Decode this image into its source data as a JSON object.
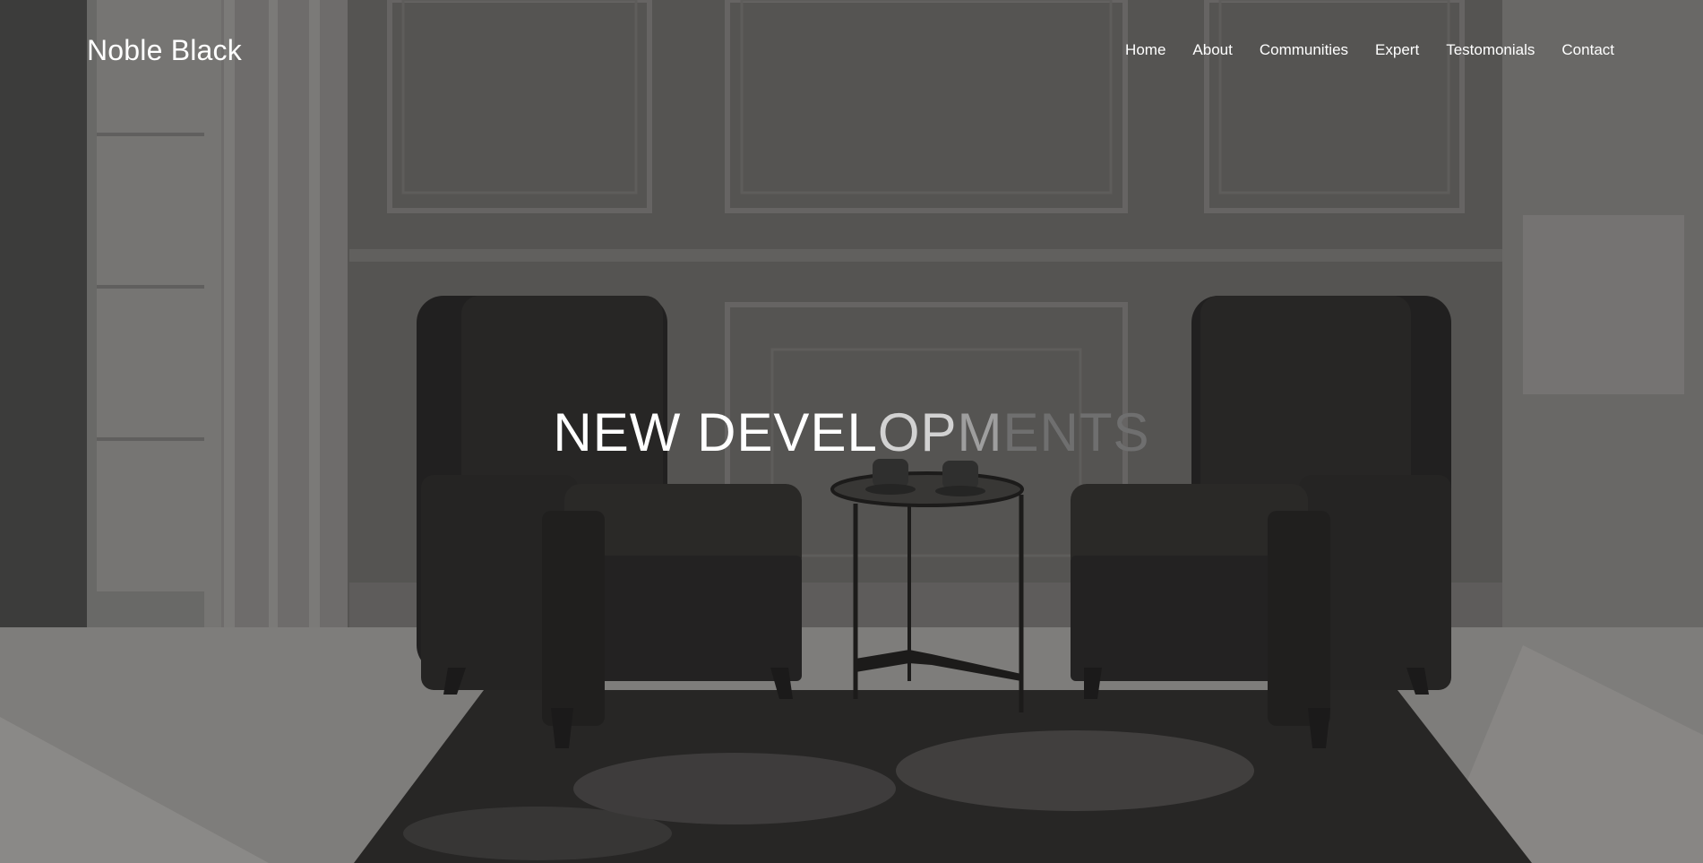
{
  "site": {
    "brand": "Noble Black"
  },
  "nav": {
    "items": [
      {
        "label": "Home"
      },
      {
        "label": "About"
      },
      {
        "label": "Communities"
      },
      {
        "label": "Expert"
      },
      {
        "label": "Testomonials"
      },
      {
        "label": "Contact"
      }
    ]
  },
  "hero": {
    "headline_parts": [
      "NEW DEVEL",
      "OP",
      "M",
      "ENTS"
    ],
    "headline_colors": [
      "#ffffff",
      "#d2d2d2",
      "#9e9e9e",
      "#6f6f6f"
    ],
    "background": "living-room-image"
  }
}
